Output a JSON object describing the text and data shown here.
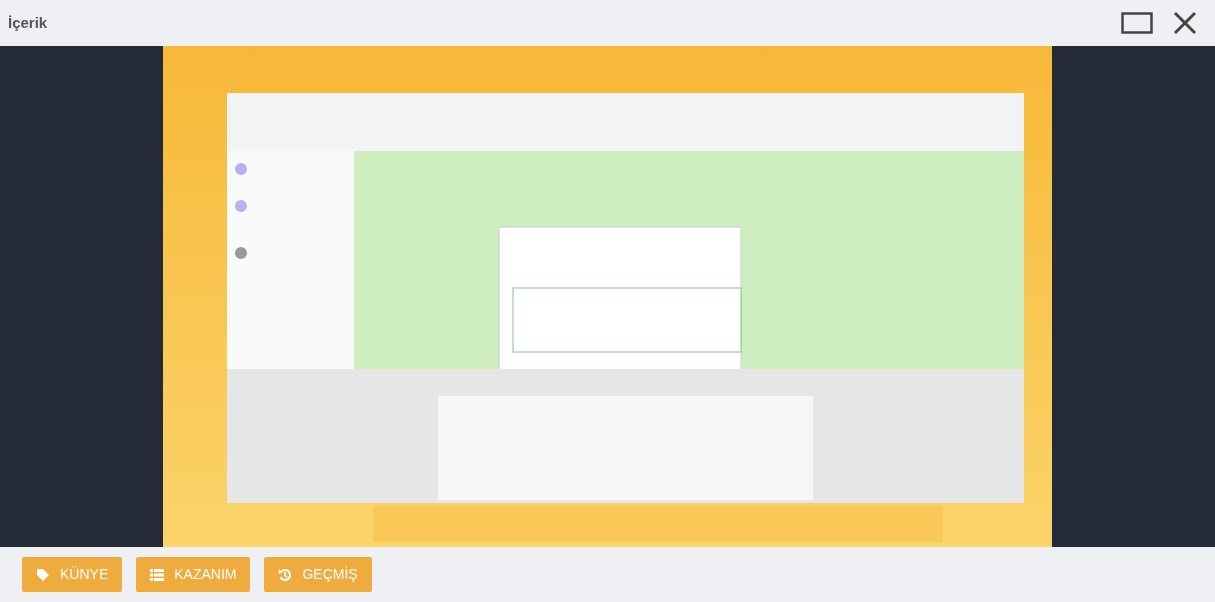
{
  "window": {
    "title": "İçerik"
  },
  "buttons": [
    {
      "label": "KÜNYE",
      "kind": "tag"
    },
    {
      "label": "KAZANIM",
      "kind": "list"
    },
    {
      "label": "GEÇMİŞ",
      "kind": "history"
    }
  ]
}
